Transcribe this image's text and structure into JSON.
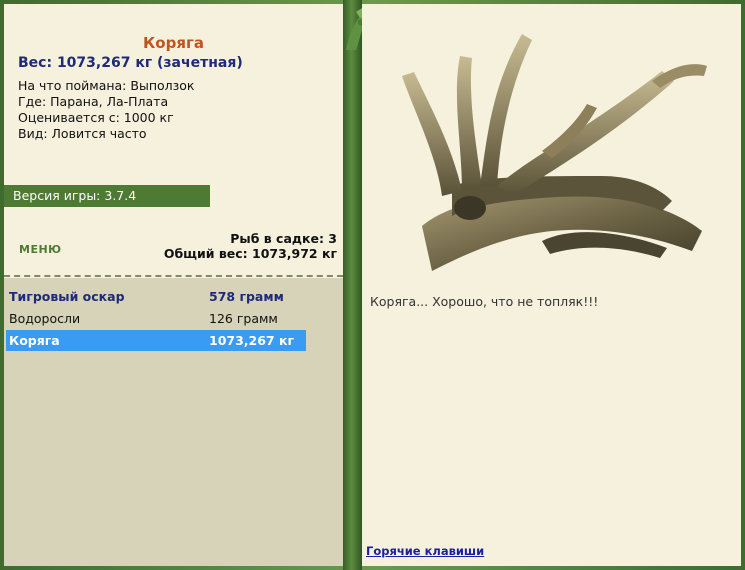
{
  "fish": {
    "name": "Коряга",
    "weight": "Вес: 1073,267 кг (зачетная)",
    "caught_on": "На что поймана: Выползок",
    "where": "Где: Парана, Ла-Плата",
    "valued_from": "Оценивается с: 1000 кг",
    "kind": "Вид: Ловится часто"
  },
  "version": "Версия игры: 3.7.4",
  "menu_label": "МЕНЮ",
  "keepnet": {
    "count": "Рыб в садке: 3",
    "total_weight": "Общий вес: 1073,972 кг"
  },
  "catch_list": [
    {
      "name": "Тигровый оскар",
      "weight": "578 грамм"
    },
    {
      "name": "Водоросли",
      "weight": "126 грамм"
    },
    {
      "name": "Коряга",
      "weight": "1073,267 кг"
    }
  ],
  "description": "Коряга... Хорошо, что не топляк!!!",
  "hotkeys_link": "Горячие клавиши",
  "colors": {
    "frame": "#4e7a3a",
    "panel": "#f5f1dd",
    "selected_row": "#3a9bf2",
    "title": "#c0531e",
    "accent_blue": "#1f2a78"
  }
}
